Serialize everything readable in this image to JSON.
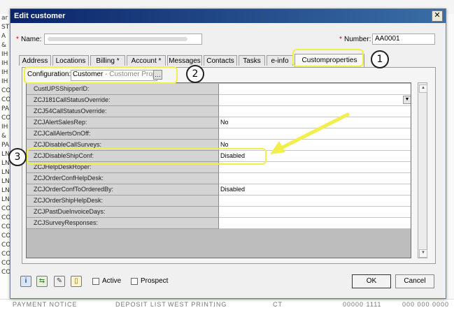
{
  "background": {
    "left_rows": [
      "ar",
      "ST",
      "A",
      "&",
      "IH",
      "IH",
      "IH",
      "IH",
      "CO",
      "CO",
      "PA",
      "CO",
      "IH",
      "&",
      "PA",
      "LN",
      "LN",
      "LN",
      "LN",
      "LN",
      "LN",
      "CO",
      "CO",
      "CO",
      "CO",
      "CO",
      "CO",
      "CO",
      "CO"
    ],
    "bottom_cols": [
      "PAYMENT NOTICE",
      "DEPOSIT LIST",
      "WEST PRINTING",
      "CT",
      "00000 1111",
      "000 000 0000"
    ]
  },
  "dialog": {
    "title": "Edit customer",
    "close_glyph": "✕",
    "name_label": "Name:",
    "name_value": "",
    "number_label": "Number:",
    "number_value": "AA0001",
    "required_mark": "*"
  },
  "tabs": [
    {
      "label": "Address"
    },
    {
      "label": "Locations"
    },
    {
      "label": "Billing *"
    },
    {
      "label": "Account *"
    },
    {
      "label": "Messages"
    },
    {
      "label": "Contacts"
    },
    {
      "label": "Tasks"
    },
    {
      "label": "e-info"
    },
    {
      "label": "Customproperties"
    }
  ],
  "configuration": {
    "label": "Configuration:",
    "value": "Customer",
    "hint": " - Customer Propert",
    "button_glyph": "…"
  },
  "properties": [
    {
      "name": "CustUPSShipperID:",
      "value": ""
    },
    {
      "name": "ZCJ181CallStatusOverride:",
      "value": ""
    },
    {
      "name": "ZCJ54CallStatusOverride:",
      "value": ""
    },
    {
      "name": "ZCJAlertSalesRep:",
      "value": "No"
    },
    {
      "name": "ZCJCallAlertsOnOff:",
      "value": ""
    },
    {
      "name": "ZCJDisableCallSurveys:",
      "value": "No"
    },
    {
      "name": "ZCJDisableShipConf:",
      "value": "Disabled"
    },
    {
      "name": "ZCJHelpDeskRoper:",
      "value": ""
    },
    {
      "name": "ZCJOrderConfHelpDesk:",
      "value": ""
    },
    {
      "name": "ZCJOrderConfToOrderedBy:",
      "value": "Disabled"
    },
    {
      "name": "ZCJOrderShipHelpDesk:",
      "value": ""
    },
    {
      "name": "ZCJPastDueInvoiceDays:",
      "value": ""
    },
    {
      "name": "ZCJSurveyResponses:",
      "value": ""
    }
  ],
  "scroll": {
    "up": "▲",
    "down": "▼"
  },
  "dropdown_glyph": "▼",
  "footer": {
    "icons": [
      {
        "name": "info-icon",
        "glyph": "i"
      },
      {
        "name": "refresh-icon",
        "glyph": "⇆"
      },
      {
        "name": "attachment-icon",
        "glyph": "✎"
      },
      {
        "name": "document-icon",
        "glyph": "▯"
      }
    ],
    "active_label": "Active",
    "prospect_label": "Prospect",
    "ok_label": "OK",
    "cancel_label": "Cancel"
  },
  "callouts": [
    {
      "number": "1"
    },
    {
      "number": "2"
    },
    {
      "number": "3"
    }
  ],
  "colors": {
    "callout": "#f2ee4b",
    "titlebar": "#0a246a",
    "required": "#d00000"
  }
}
